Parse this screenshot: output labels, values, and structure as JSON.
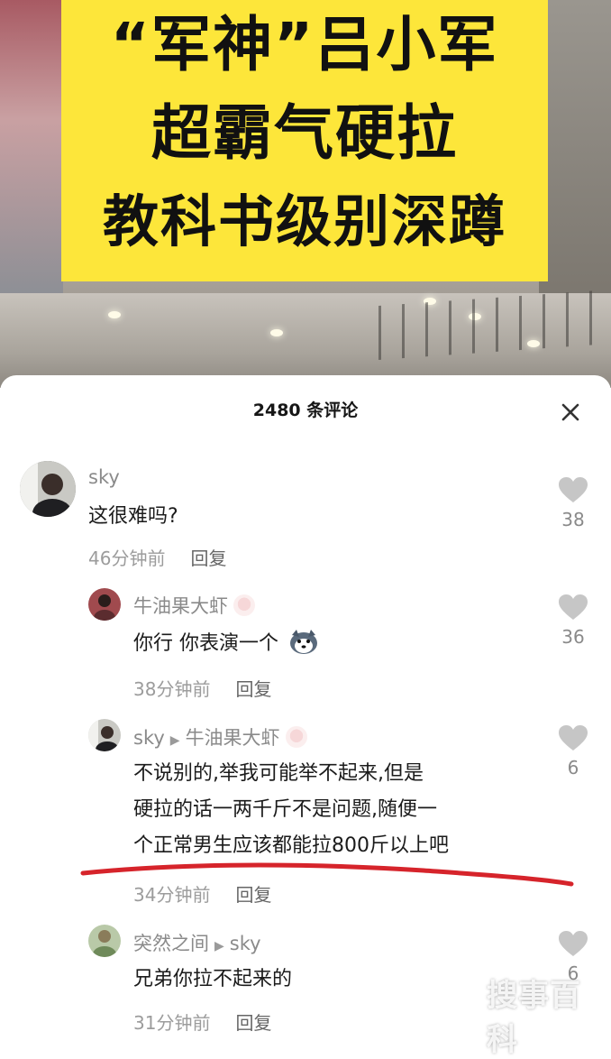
{
  "video": {
    "banner_lines": [
      "“军神”吕小军",
      "超霸气硬拉",
      "教科书级别深蹲"
    ]
  },
  "sheet": {
    "title": "2480 条评论",
    "close_icon": "close-icon"
  },
  "comments": [
    {
      "user": "sky",
      "text": "这很难吗?",
      "time": "46分钟前",
      "reply_label": "回复",
      "likes": "38"
    },
    {
      "user": "牛油果大虾",
      "text": "你行 你表演一个",
      "emoji": "husky-emoji",
      "time": "38分钟前",
      "reply_label": "回复",
      "likes": "36"
    },
    {
      "user": "sky",
      "reply_to": "牛油果大虾",
      "text_lines": [
        "不说别的,举我可能举不起来,但是",
        "硬拉的话一两千斤不是问题,随便一",
        "个正常男生应该都能拉800斤以上吧"
      ],
      "time": "34分钟前",
      "reply_label": "回复",
      "likes": "6"
    },
    {
      "user": "突然之间",
      "reply_to": "sky",
      "text": "兄弟你拉不起来的",
      "time": "31分钟前",
      "reply_label": "回复",
      "likes": "6"
    }
  ],
  "watermark": "搜事百科",
  "colors": {
    "banner_yellow": "#fde63a",
    "underline_red": "#d6242b",
    "like_gray": "#c6c6c6"
  }
}
